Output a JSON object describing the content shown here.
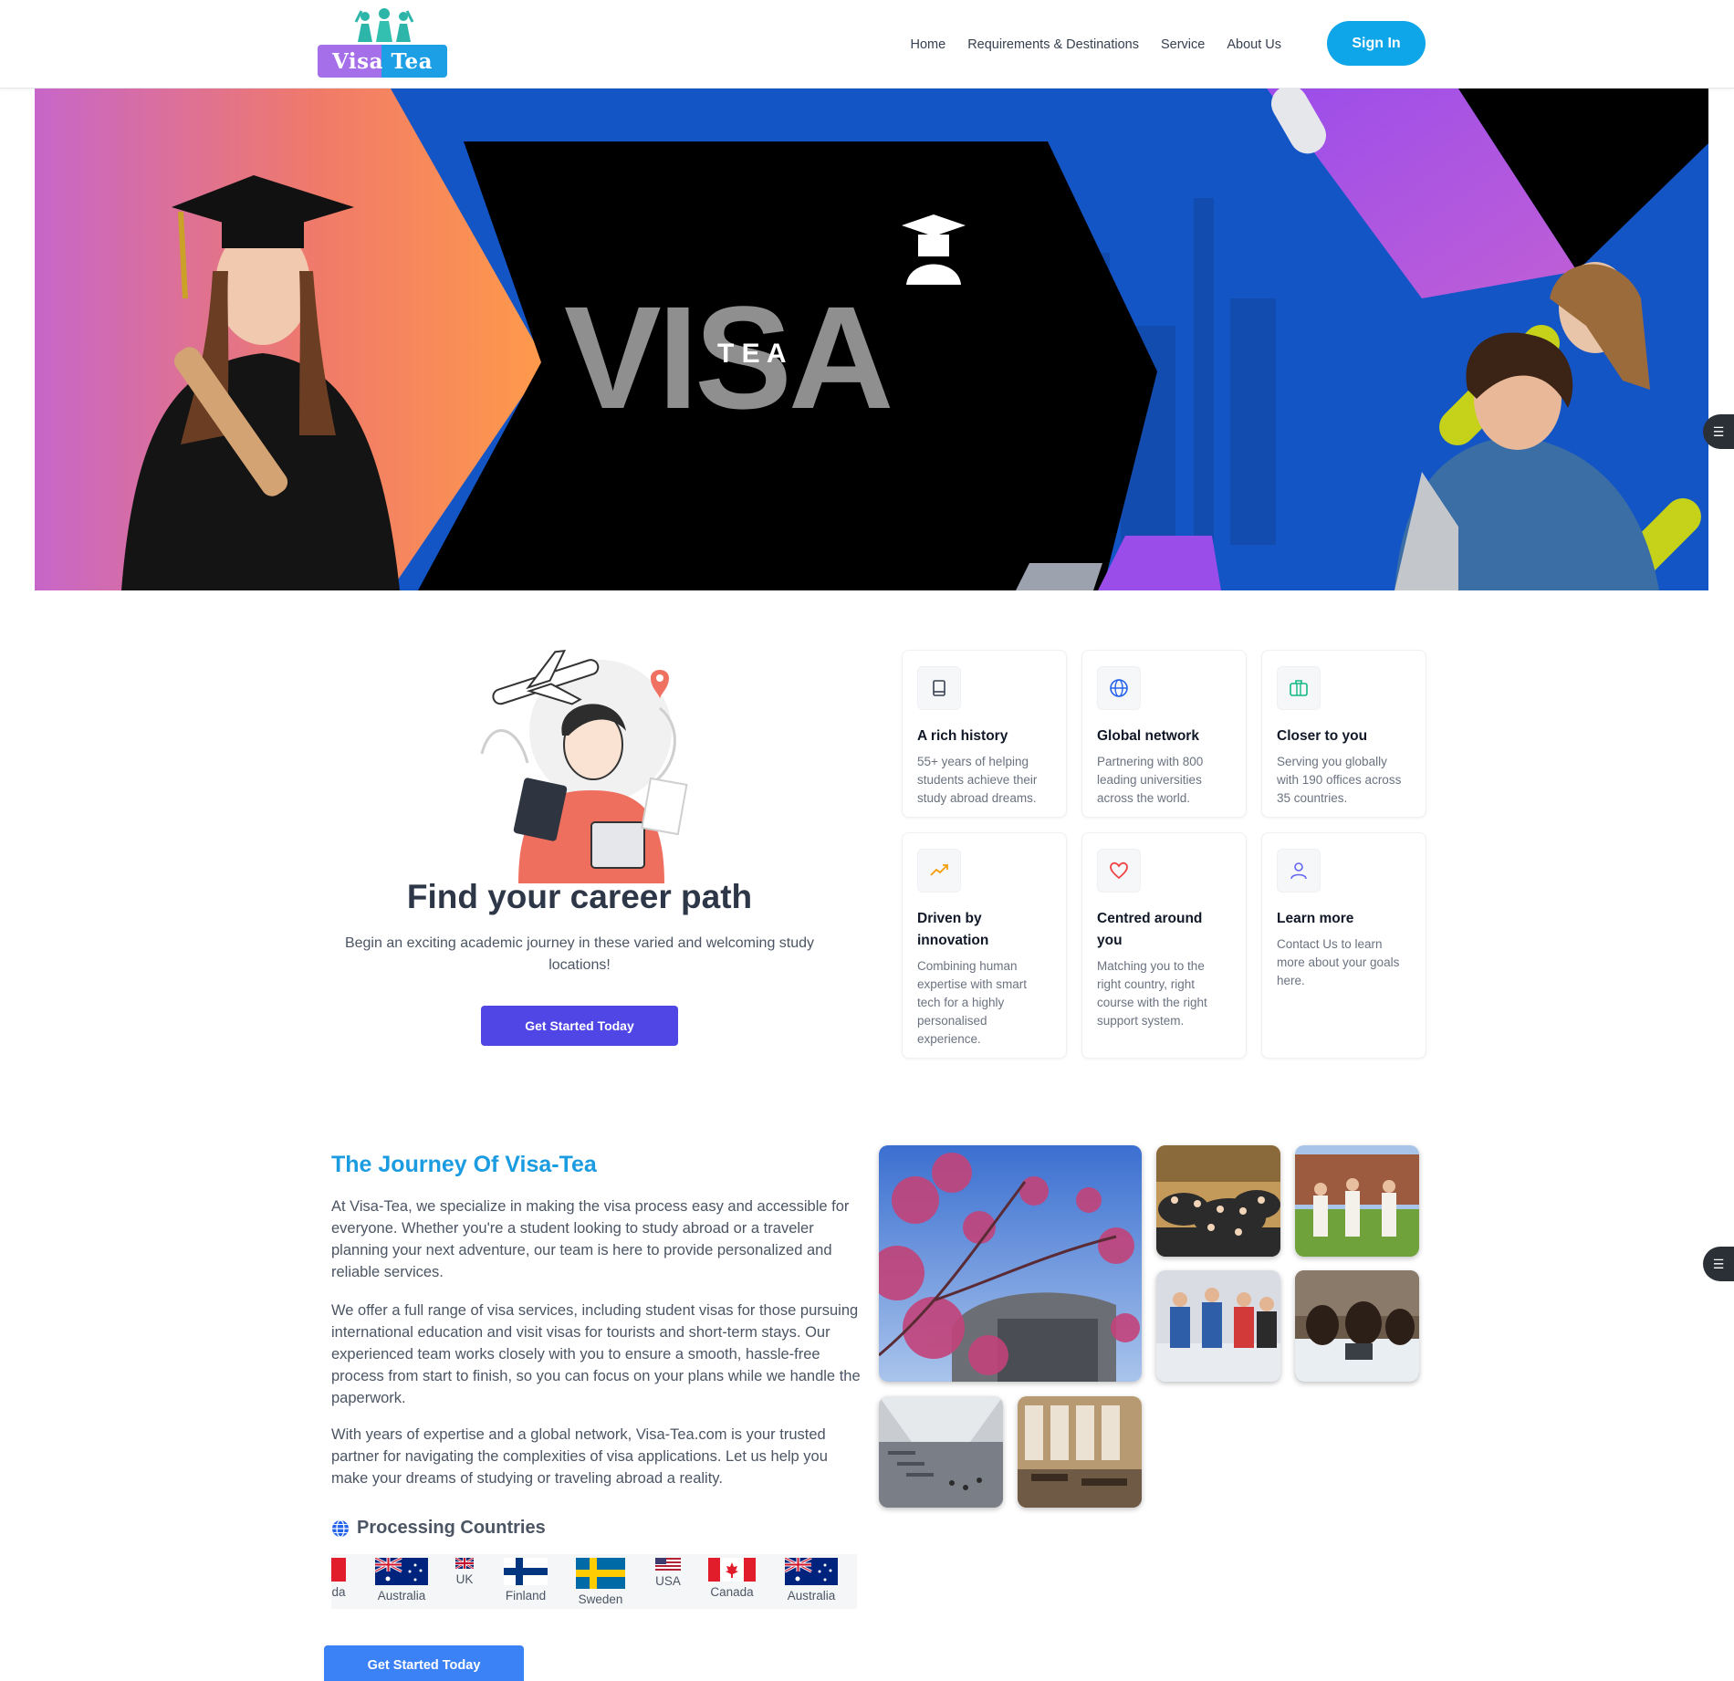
{
  "header": {
    "logo_text": "Visa Tea",
    "nav": [
      "Home",
      "Requirements & Destinations",
      "Service",
      "About Us"
    ],
    "signin_label": "Sign In"
  },
  "hero": {
    "brand_word": "VISA",
    "brand_sub": "T E A"
  },
  "career": {
    "title": "Find your career path",
    "subtitle": "Begin an exciting academic journey in these varied and welcoming study locations!",
    "button": "Get Started Today",
    "cards": [
      {
        "icon": "book-icon",
        "title": "A rich history",
        "text": "55+ years of helping students achieve their study abroad dreams."
      },
      {
        "icon": "globe-icon",
        "title": "Global network",
        "text": "Partnering with 800 leading universities across the world."
      },
      {
        "icon": "briefcase-icon",
        "title": "Closer to you",
        "text": "Serving you globally with 190 offices across 35 countries."
      },
      {
        "icon": "trending-up-icon",
        "title": "Driven by innovation",
        "text": "Combining human expertise with smart tech for a highly personalised experience."
      },
      {
        "icon": "heart-icon",
        "title": "Centred around you",
        "text": "Matching you to the right country, right course with the right support system."
      },
      {
        "icon": "user-icon",
        "title": "Learn more",
        "text": "Contact Us to learn more about your goals here."
      }
    ]
  },
  "journey": {
    "title": "The Journey Of Visa-Tea",
    "paragraphs": [
      "At Visa-Tea, we specialize in making the visa process easy and accessible for everyone. Whether you're a student looking to study abroad or a traveler planning your next adventure, our team is here to provide personalized and reliable services.",
      "We offer a full range of visa services, including student visas for those pursuing international education and visit visas for tourists and short-term stays. Our experienced team works closely with you to ensure a smooth, hassle-free process from start to finish, so you can focus on your plans while we handle the paperwork.",
      "With years of expertise and a global network, Visa-Tea.com is your trusted partner for navigating the complexities of visa applications. Let us help you make your dreams of studying or traveling abroad a reality."
    ],
    "processing_title": "Processing Countries",
    "countries": [
      "da",
      "Australia",
      "UK",
      "Finland",
      "Sweden",
      "USA",
      "Canada",
      "Australia"
    ],
    "button": "Get Started Today"
  },
  "colors": {
    "accent_blue": "#1b9be0",
    "primary_indigo": "#4f46e5",
    "signin_blue": "#0ea5e9",
    "button_blue": "#3b82f6"
  }
}
